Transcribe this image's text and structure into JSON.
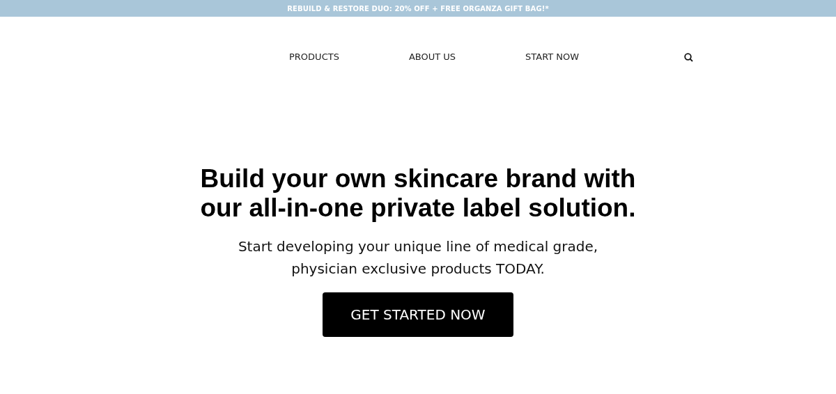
{
  "announcement_bar": {
    "text": "REBUILD & RESTORE DUO: 20% OFF + FREE ORGANZA GIFT BAG!*"
  },
  "nav": {
    "links": [
      "PRODUCTS",
      "ABOUT US",
      "START NOW"
    ]
  },
  "hero": {
    "headline": "Build your own skincare brand with our all-in-one private label solution.",
    "subtitle": "Start developing your unique line of medical grade, physician exclusive products TODAY.",
    "button": "GET STARTED NOW"
  }
}
